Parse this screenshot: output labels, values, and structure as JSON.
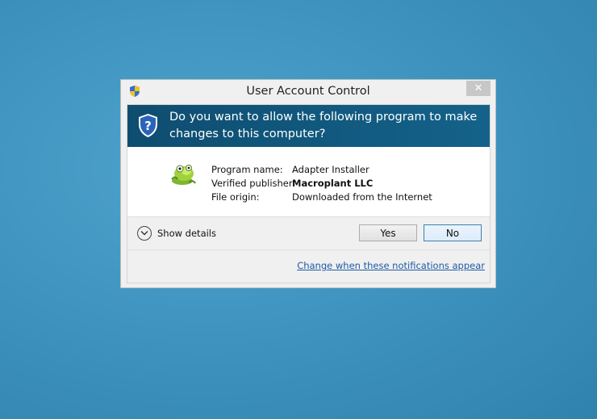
{
  "dialog": {
    "title": "User Account Control",
    "close_glyph": "✕",
    "question": "Do you want to allow the following program to make changes to this computer?",
    "details": {
      "program_name_label": "Program name:",
      "program_name_value": "Adapter Installer",
      "publisher_label": "Verified publisher:",
      "publisher_value": "Macroplant LLC",
      "origin_label": "File origin:",
      "origin_value": "Downloaded from the Internet"
    },
    "show_details_label": "Show details",
    "yes_label": "Yes",
    "no_label": "No",
    "change_link_label": "Change when these notifications appear"
  },
  "icons": {
    "title": "uac-shield-icon",
    "banner": "shield-question-icon",
    "program": "adapter-app-icon",
    "expand": "chevron-down-circle-icon",
    "close": "close-icon"
  },
  "colors": {
    "desktop": "#3f95c0",
    "banner": "#14628a",
    "link": "#1e5aa8",
    "default_button_border": "#3c7fb1"
  }
}
